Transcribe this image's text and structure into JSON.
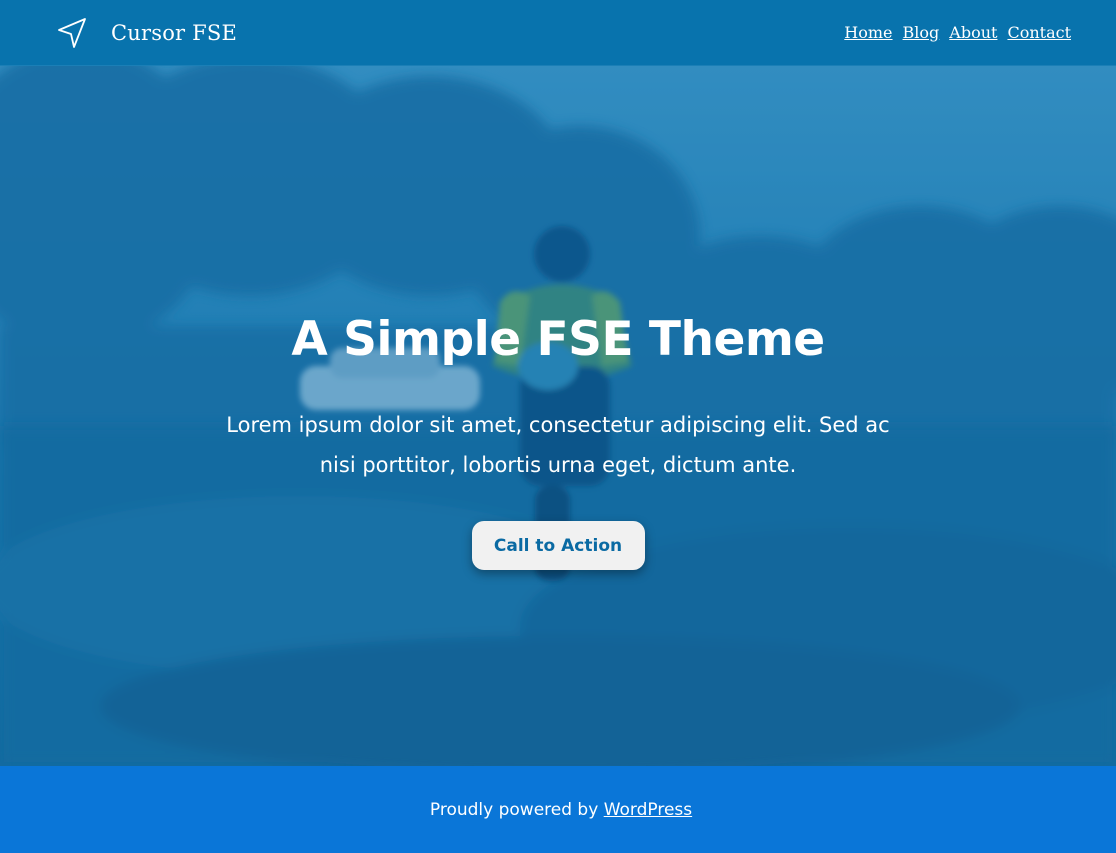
{
  "header": {
    "site_title": "Cursor FSE",
    "logo_icon": "paper-plane-icon",
    "nav": [
      {
        "label": "Home"
      },
      {
        "label": "Blog"
      },
      {
        "label": "About"
      },
      {
        "label": "Contact"
      }
    ]
  },
  "hero": {
    "title": "A Simple FSE Theme",
    "text": "Lorem ipsum dolor sit amet, consectetur adipiscing elit. Sed ac nisi porttitor, lobortis urna eget, dictum ante.",
    "cta_label": "Call to Action",
    "overlay_color": "#0a6fa8"
  },
  "footer": {
    "prefix": "Proudly powered by",
    "link_label": "WordPress"
  },
  "colors": {
    "header_bg": "#0873ad",
    "footer_bg": "#0a76d8",
    "cta_text": "#0a6aa3",
    "cta_bg": "#f1f1f1"
  }
}
